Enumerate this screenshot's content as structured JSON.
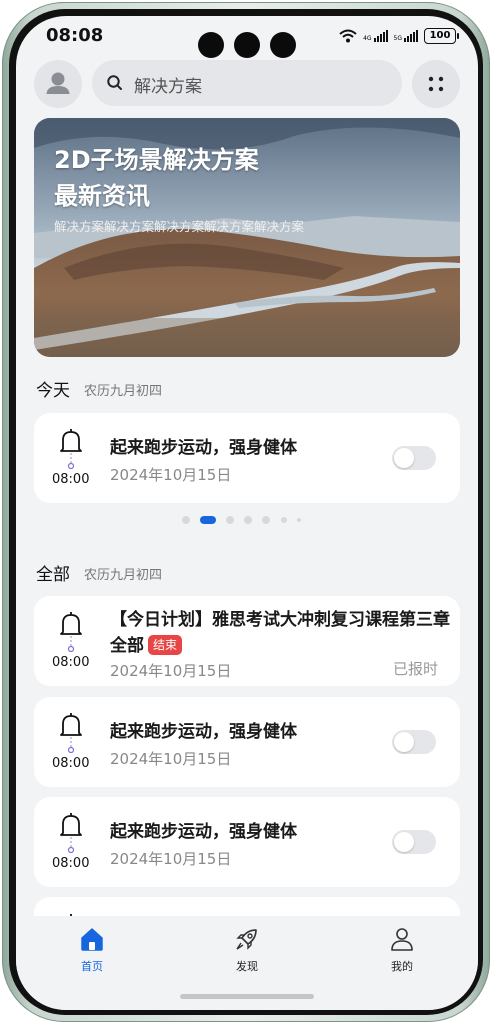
{
  "status_bar": {
    "time": "08:08",
    "battery": "100",
    "signal_label_1": "4G",
    "signal_label_2": "5G"
  },
  "search": {
    "placeholder": "解决方案"
  },
  "banner": {
    "title_line1": "2D子场景解决方案",
    "title_line2": "最新资讯",
    "subtitle": "解决方案解决方案解决方案解决方案解决方案"
  },
  "today": {
    "title": "今天",
    "lunar": "农历九月初四",
    "card": {
      "time": "08:00",
      "title": "起来跑步运动，强身健体",
      "date": "2024年10月15日",
      "toggle_on": false
    }
  },
  "pager": {
    "count": 7,
    "active_index": 1
  },
  "all": {
    "title": "全部",
    "lunar": "农历九月初四",
    "items": [
      {
        "time": "08:00",
        "title": "【今日计划】雅思考试大冲刺复习课程第三章全部",
        "tag": "结束",
        "date": "2024年10月15日",
        "status": "已报时"
      },
      {
        "time": "08:00",
        "title": "起来跑步运动，强身健体",
        "date": "2024年10月15日",
        "toggle_on": false
      },
      {
        "time": "08:00",
        "title": "起来跑步运动，强身健体",
        "date": "2024年10月15日",
        "toggle_on": false
      }
    ]
  },
  "tabbar": {
    "tabs": [
      {
        "label": "首页",
        "icon": "home-icon",
        "active": true
      },
      {
        "label": "发现",
        "icon": "rocket-icon",
        "active": false
      },
      {
        "label": "我的",
        "icon": "user-icon",
        "active": false
      }
    ]
  },
  "colors": {
    "accent": "#1766e0",
    "tag_red": "#e84646",
    "background": "#f1f3f5"
  }
}
